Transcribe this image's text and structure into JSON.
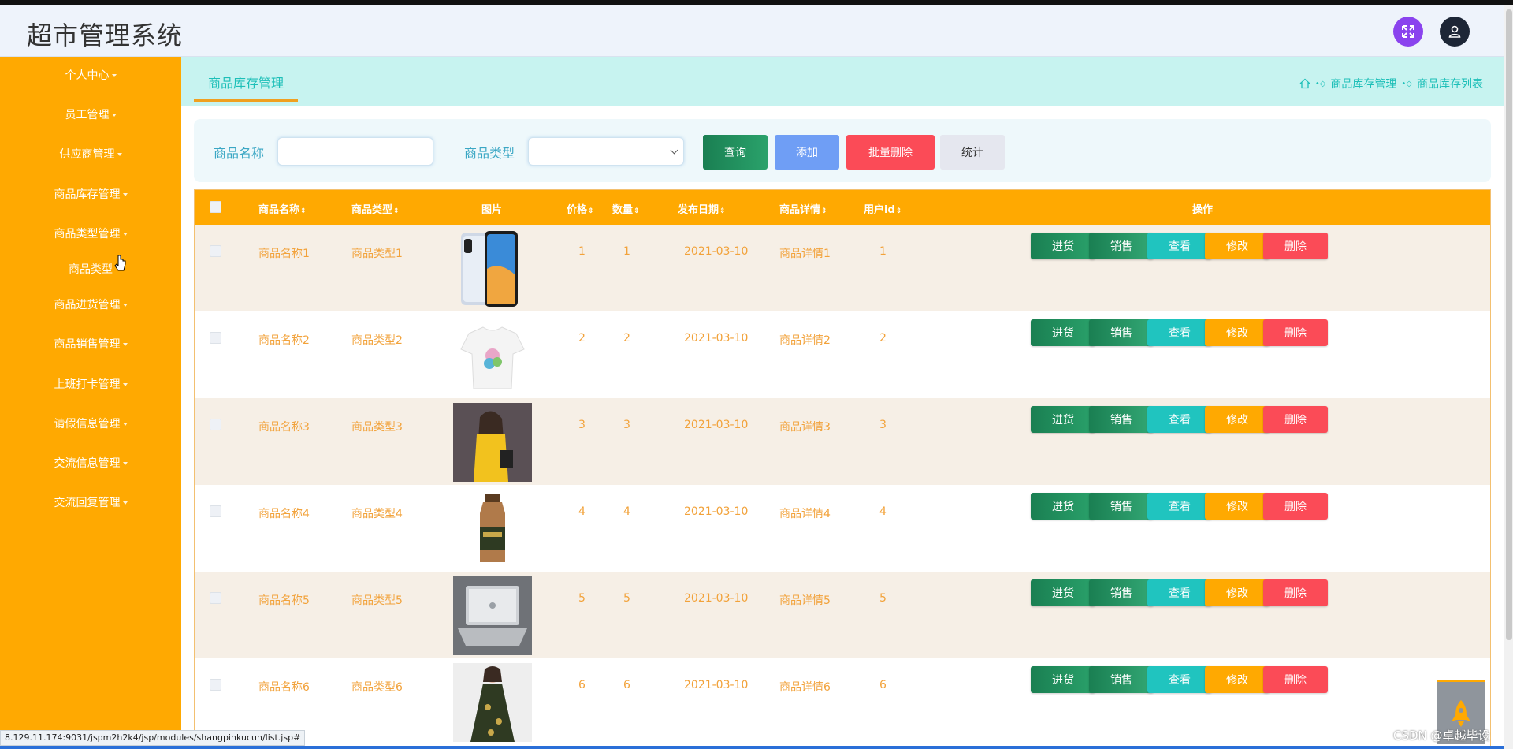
{
  "header": {
    "title": "超市管理系统",
    "fullscreen_icon": "expand-icon",
    "user_icon": "user-icon"
  },
  "sidebar": {
    "items": [
      {
        "label": "个人中心",
        "caret": true
      },
      {
        "label": "员工管理",
        "caret": true
      },
      {
        "label": "供应商管理",
        "caret": true
      },
      {
        "label": "商品库存管理",
        "caret": true
      },
      {
        "label": "商品类型管理",
        "caret": true
      },
      {
        "label": "商品类型",
        "caret": false
      },
      {
        "label": "商品进货管理",
        "caret": true
      },
      {
        "label": "商品销售管理",
        "caret": true
      },
      {
        "label": "上班打卡管理",
        "caret": true
      },
      {
        "label": "请假信息管理",
        "caret": true
      },
      {
        "label": "交流信息管理",
        "caret": true
      },
      {
        "label": "交流回复管理",
        "caret": true
      }
    ]
  },
  "crumb": {
    "tab": "商品库存管理",
    "path1": "商品库存管理",
    "path2": "商品库存列表"
  },
  "search": {
    "name_label": "商品名称",
    "name_value": "",
    "type_label": "商品类型",
    "type_value": "",
    "btn_query": "查询",
    "btn_add": "添加",
    "btn_batch_delete": "批量删除",
    "btn_stats": "统计"
  },
  "table": {
    "headers": [
      "商品名称",
      "商品类型",
      "图片",
      "价格",
      "数量",
      "发布日期",
      "商品详情",
      "用户id",
      "操作"
    ],
    "rows": [
      {
        "name": "商品名称1",
        "type": "商品类型1",
        "image": "phone",
        "price": "1",
        "qty": "1",
        "date": "2021-03-10",
        "detail": "商品详情1",
        "uid": "1"
      },
      {
        "name": "商品名称2",
        "type": "商品类型2",
        "image": "tshirt",
        "price": "2",
        "qty": "2",
        "date": "2021-03-10",
        "detail": "商品详情2",
        "uid": "2"
      },
      {
        "name": "商品名称3",
        "type": "商品类型3",
        "image": "woman-yellow",
        "price": "3",
        "qty": "3",
        "date": "2021-03-10",
        "detail": "商品详情3",
        "uid": "3"
      },
      {
        "name": "商品名称4",
        "type": "商品类型4",
        "image": "bottle",
        "price": "4",
        "qty": "4",
        "date": "2021-03-10",
        "detail": "商品详情4",
        "uid": "4"
      },
      {
        "name": "商品名称5",
        "type": "商品类型5",
        "image": "laptop",
        "price": "5",
        "qty": "5",
        "date": "2021-03-10",
        "detail": "商品详情5",
        "uid": "5"
      },
      {
        "name": "商品名称6",
        "type": "商品类型6",
        "image": "woman-dress",
        "price": "6",
        "qty": "6",
        "date": "2021-03-10",
        "detail": "商品详情6",
        "uid": "6"
      }
    ],
    "actions": [
      "进货",
      "销售",
      "查看",
      "修改",
      "删除"
    ]
  },
  "statusbar": {
    "url": "8.129.11.174:9031/jspm2h2k4/jsp/modules/shangpinkucun/list.jsp#"
  },
  "watermark": "CSDN @卓越毕设",
  "colors": {
    "sidebar": "#ffa901",
    "accent": "#1dbfb8",
    "danger": "#fb4b57",
    "primary": "#1a7f52"
  }
}
